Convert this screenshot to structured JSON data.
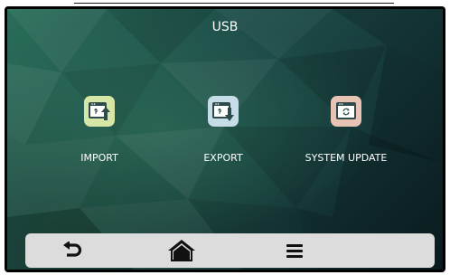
{
  "header": {
    "title": "USB"
  },
  "tiles": [
    {
      "label": "IMPORT",
      "icon": "usb-import-icon",
      "color": "#d6e6a6"
    },
    {
      "label": "EXPORT",
      "icon": "usb-export-icon",
      "color": "#c6dde8"
    },
    {
      "label": "SYSTEM UPDATE",
      "icon": "system-update-icon",
      "color": "#e8c3b3"
    }
  ],
  "bottom_bar": {
    "buttons": [
      {
        "icon": "back-arrow-icon"
      },
      {
        "icon": "home-icon"
      },
      {
        "icon": "menu-icon"
      }
    ]
  }
}
